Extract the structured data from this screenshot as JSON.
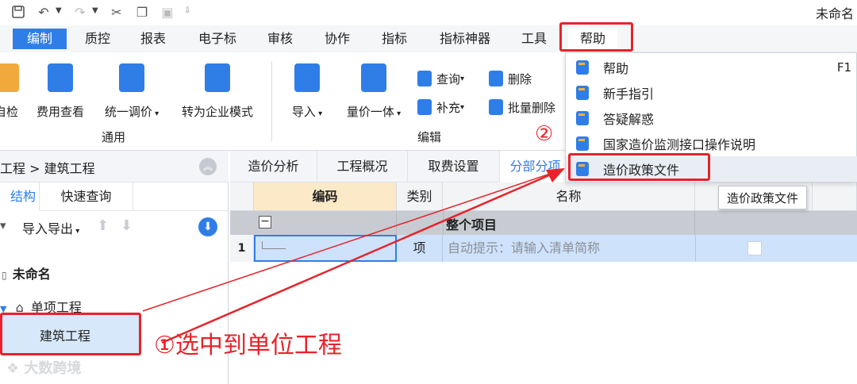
{
  "window": {
    "title": "未命名"
  },
  "menu_tabs": [
    {
      "label": "编制",
      "active": true
    },
    {
      "label": "质控"
    },
    {
      "label": "报表"
    },
    {
      "label": "电子标"
    },
    {
      "label": "审核"
    },
    {
      "label": "协作"
    },
    {
      "label": "指标"
    },
    {
      "label": "指标神器"
    },
    {
      "label": "工具"
    },
    {
      "label": "帮助"
    }
  ],
  "ribbon": {
    "general_group": "通用",
    "edit_group": "编辑",
    "buttons": {
      "self_check": "自检",
      "fee_view": "费用查看",
      "unified_price": "统一调价",
      "enterprise_mode": "转为企业模式",
      "import": "导入",
      "qty_price": "量价一体",
      "query": "查询",
      "supplement": "补充",
      "delete": "删除",
      "batch_delete": "批量删除"
    }
  },
  "help_menu": {
    "items": [
      {
        "label": "帮助",
        "shortcut": "F1"
      },
      {
        "label": "新手指引"
      },
      {
        "label": "答疑解惑"
      },
      {
        "label": "国家造价监测接口操作说明"
      },
      {
        "label": "造价政策文件"
      }
    ],
    "tooltip": "造价政策文件"
  },
  "left_panel": {
    "breadcrumb": "工程 > 建筑工程",
    "tabs": [
      "结构",
      "快速查询"
    ],
    "toolbar_label": "导入导出",
    "tree": {
      "root": "未命名",
      "child": "单项工程",
      "leaf": "建筑工程"
    }
  },
  "right_panel": {
    "tabs": [
      "造价分析",
      "工程概况",
      "取费设置",
      "分部分项"
    ],
    "columns": {
      "code": "编码",
      "category": "类别",
      "name": "名称"
    },
    "rows": [
      {
        "group_label": "整个项目",
        "toggle": "−"
      },
      {
        "num": "1",
        "category": "项",
        "name": "自动提示：请输入清单简称"
      }
    ]
  },
  "annotations": {
    "step1": "①选中到单位工程",
    "step2": "②"
  },
  "watermark": "大数跨境",
  "colors": {
    "accent": "#2f7ee8",
    "annotation": "#e8222a"
  }
}
